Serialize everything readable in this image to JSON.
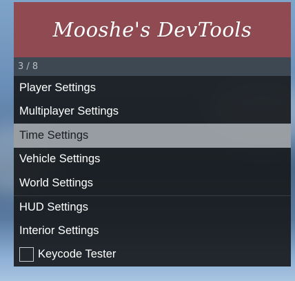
{
  "banner": {
    "title": "Mooshe's DevTools"
  },
  "subheader": {
    "counter": "3 / 8"
  },
  "menu": {
    "items": [
      {
        "label": "Player Settings"
      },
      {
        "label": "Multiplayer Settings"
      },
      {
        "label": "Time Settings",
        "selected": true
      },
      {
        "label": "Vehicle Settings"
      },
      {
        "label": "World Settings"
      },
      {
        "label": "HUD Settings"
      },
      {
        "label": "Interior Settings"
      },
      {
        "label": "Keycode Tester",
        "checkbox": true,
        "checked": false
      }
    ]
  },
  "colors": {
    "banner": "#8f4a52",
    "subheader": "#3e4852",
    "item_background": "#16181b",
    "selected_background": "#c8cdd2"
  }
}
